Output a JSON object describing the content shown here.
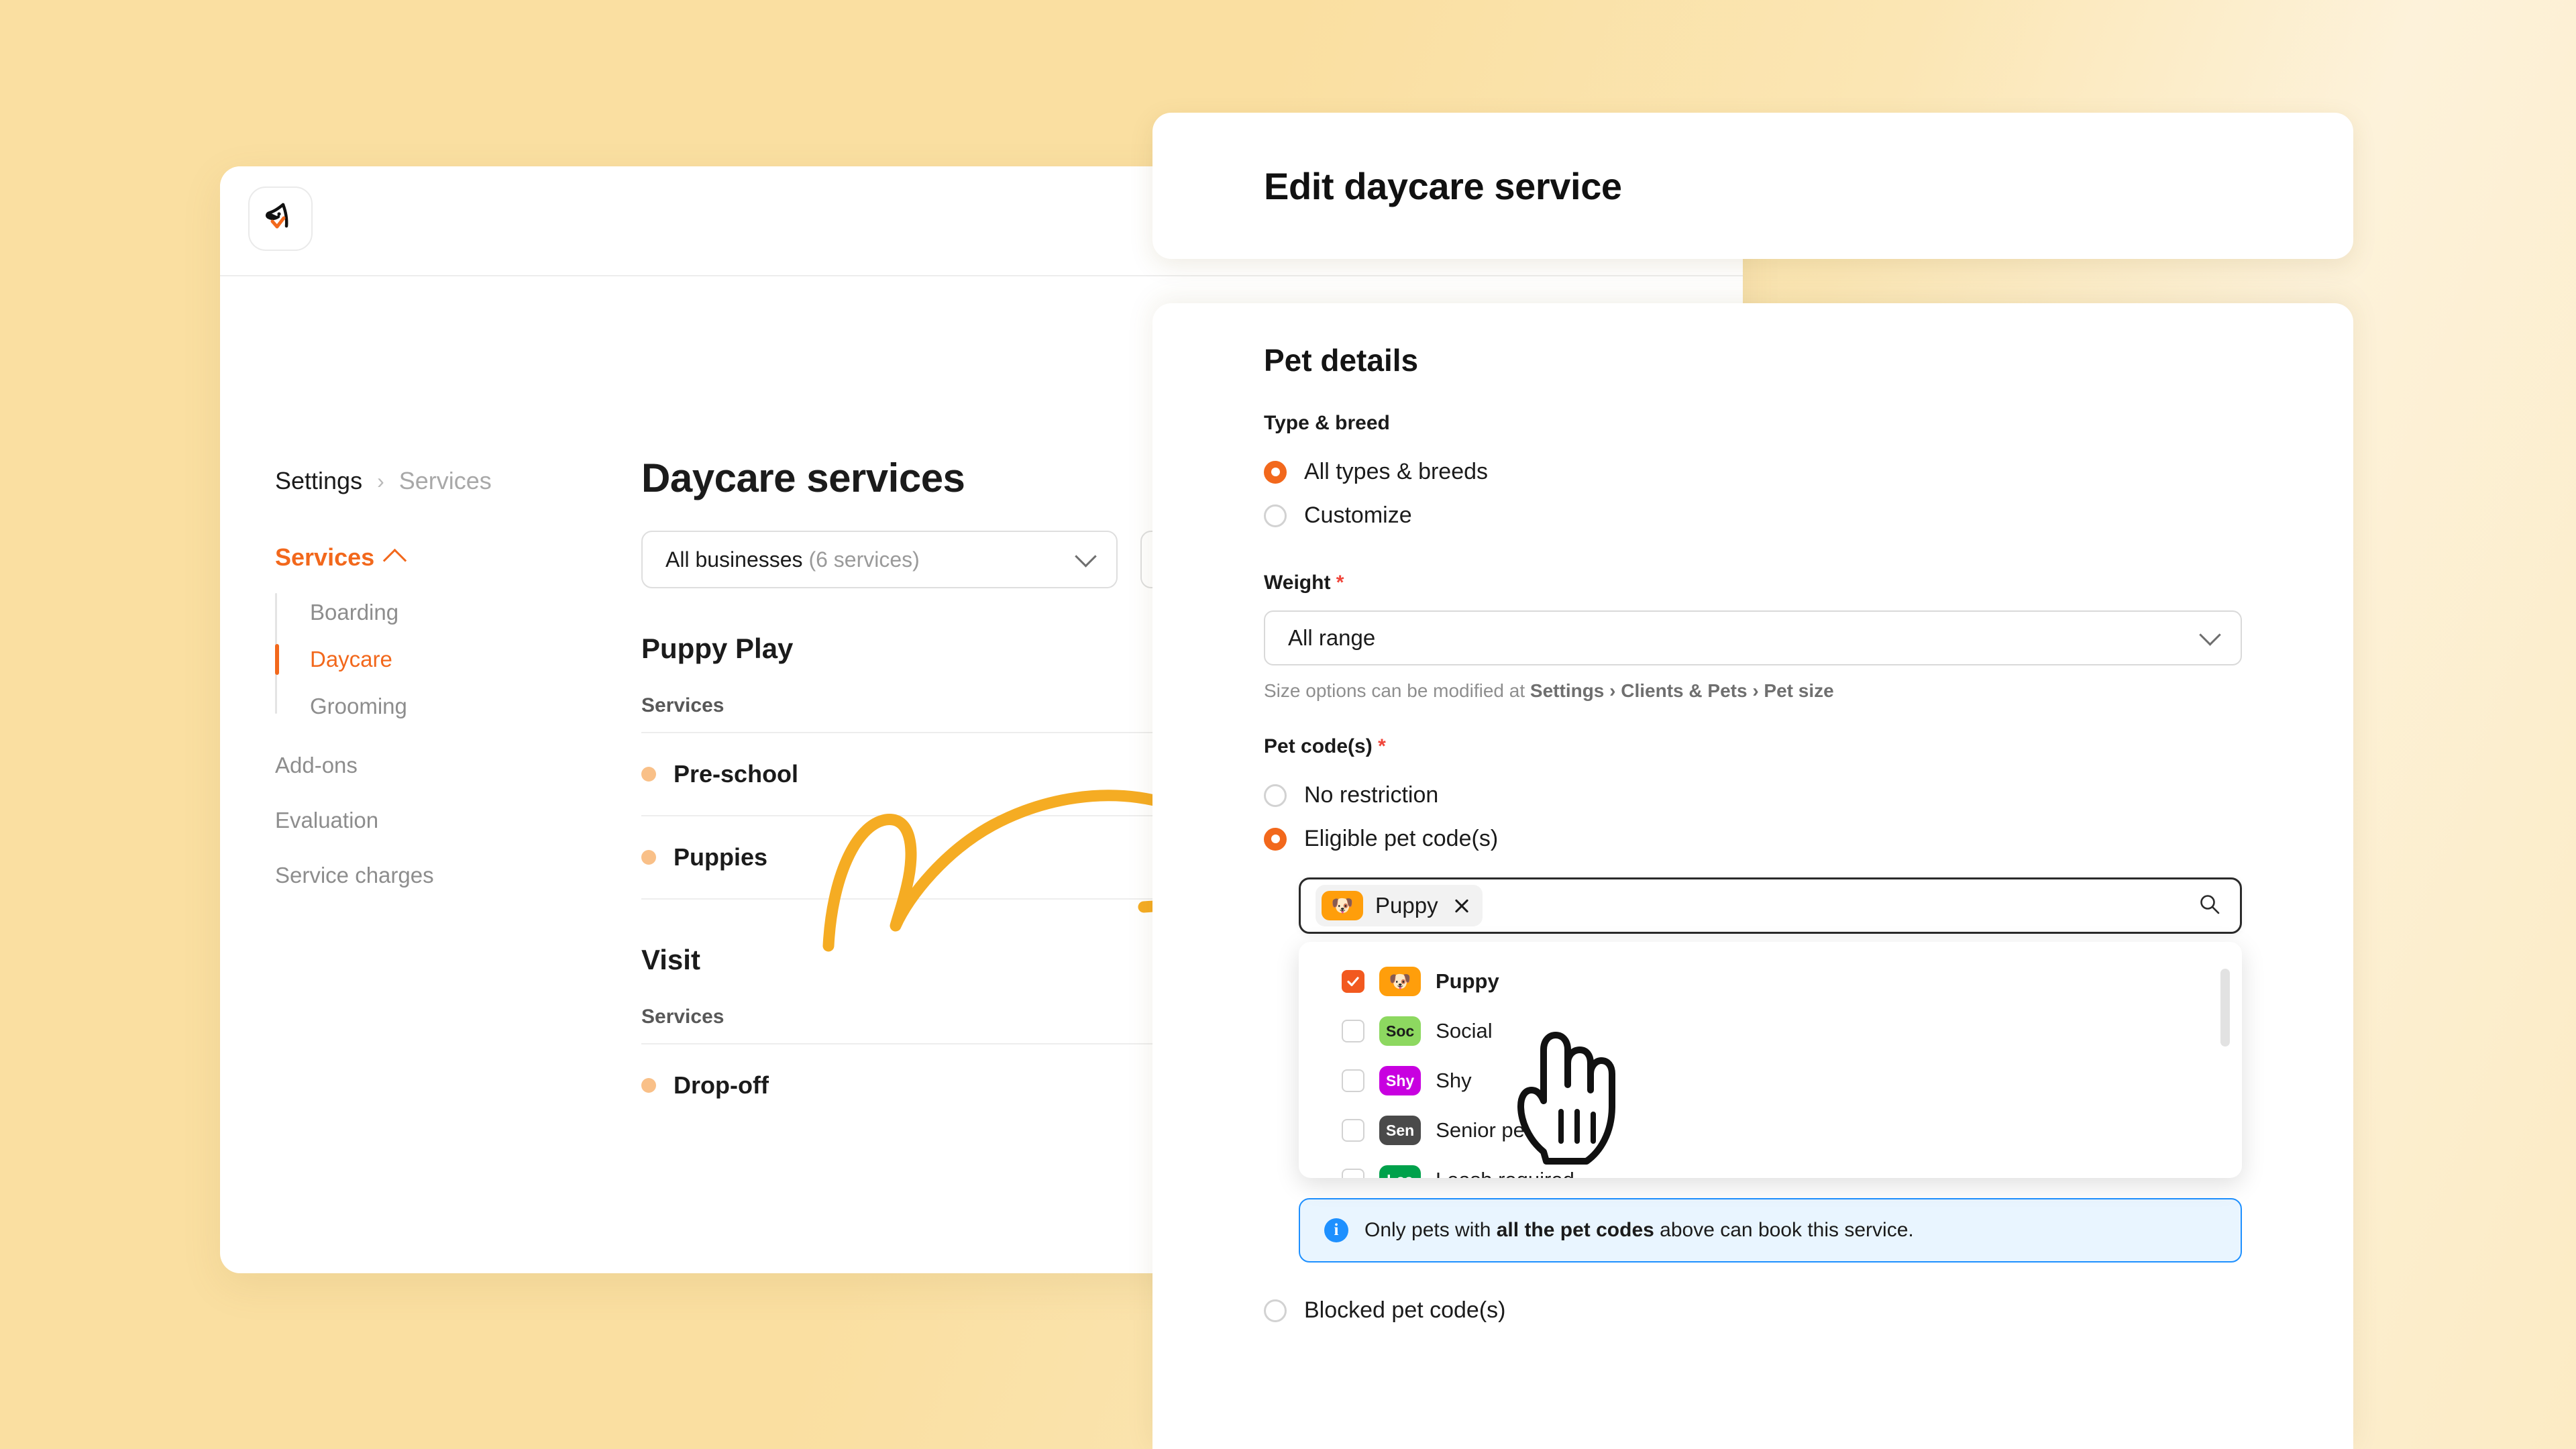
{
  "app": {
    "logo_icon": "dog-head-check-logo"
  },
  "breadcrumb": {
    "root": "Settings",
    "separator": "›",
    "leaf": "Services"
  },
  "sidebar": {
    "group": {
      "label": "Services",
      "icon": "chevron-up-icon",
      "expanded": true
    },
    "sub_items": [
      {
        "label": "Boarding",
        "active": false
      },
      {
        "label": "Daycare",
        "active": true
      },
      {
        "label": "Grooming",
        "active": false
      }
    ],
    "items": [
      {
        "label": "Add-ons"
      },
      {
        "label": "Evaluation"
      },
      {
        "label": "Service charges"
      }
    ]
  },
  "main": {
    "page_title": "Daycare services",
    "filters": {
      "business": {
        "label": "All businesses",
        "count_label": "(6 services)",
        "icon": "chevron-down-icon"
      }
    },
    "groups": [
      {
        "title": "Puppy Play",
        "column_header": "Services",
        "rows": [
          {
            "name": "Pre-school",
            "dot_color": "#F9C088"
          },
          {
            "name": "Puppies",
            "dot_color": "#F9C088"
          }
        ]
      },
      {
        "title": "Visit",
        "column_header": "Services",
        "rows": [
          {
            "name": "Drop-off",
            "dot_color": "#F9C088"
          }
        ]
      }
    ]
  },
  "modal": {
    "title": "Edit daycare service",
    "section_title": "Pet details",
    "type_breed": {
      "label": "Type & breed",
      "options": [
        {
          "label": "All types & breeds",
          "selected": true
        },
        {
          "label": "Customize",
          "selected": false
        }
      ]
    },
    "weight": {
      "label": "Weight",
      "required_mark": "*",
      "value": "All range",
      "icon": "chevron-down-icon",
      "helper_prefix": "Size options can be modified at ",
      "helper_path": "Settings › Clients & Pets › Pet size"
    },
    "pet_codes": {
      "label": "Pet code(s)",
      "required_mark": "*",
      "options": [
        {
          "label": "No restriction",
          "selected": false
        },
        {
          "label": "Eligible pet code(s)",
          "selected": true
        },
        {
          "label": "Blocked pet code(s)",
          "selected": false
        }
      ],
      "combobox": {
        "search_icon": "search-icon",
        "chips": [
          {
            "label": "Puppy",
            "emoji": "🐶",
            "badge_color": "#FF9E0B",
            "remove_icon": "close-icon"
          }
        ]
      },
      "dropdown": {
        "items": [
          {
            "label": "Puppy",
            "badge_text": "",
            "emoji": "🐶",
            "badge_color": "#FF9E0B",
            "checked": true
          },
          {
            "label": "Social",
            "badge_text": "Soc",
            "emoji": "",
            "badge_color": "#8DD860",
            "checked": false
          },
          {
            "label": "Shy",
            "badge_text": "Shy",
            "emoji": "",
            "badge_color": "#C800E0",
            "checked": false
          },
          {
            "label": "Senior pet",
            "badge_text": "Sen",
            "emoji": "",
            "badge_color": "#4A4A4A",
            "checked": false
          },
          {
            "label": "Leash required",
            "badge_text": "Lea",
            "emoji": "",
            "badge_color": "#00A14B",
            "checked": false
          }
        ]
      },
      "info_banner": {
        "icon": "info-icon",
        "text_before": "Only pets with ",
        "text_bold": "all the pet codes",
        "text_after": " above can book this service.",
        "accent_color": "#1E90FF"
      }
    }
  },
  "annotations": {
    "arrow": {
      "color": "#F5AC23",
      "shape": "hand-drawn-curved-arrow"
    },
    "cursor": {
      "shape": "pointing-hand-cursor"
    }
  },
  "theme": {
    "background": "#FADFA1",
    "accent_orange": "#F2681C",
    "checkbox_orange": "#F2591F",
    "required_red": "#F0453A",
    "info_blue": "#1E90FF"
  }
}
